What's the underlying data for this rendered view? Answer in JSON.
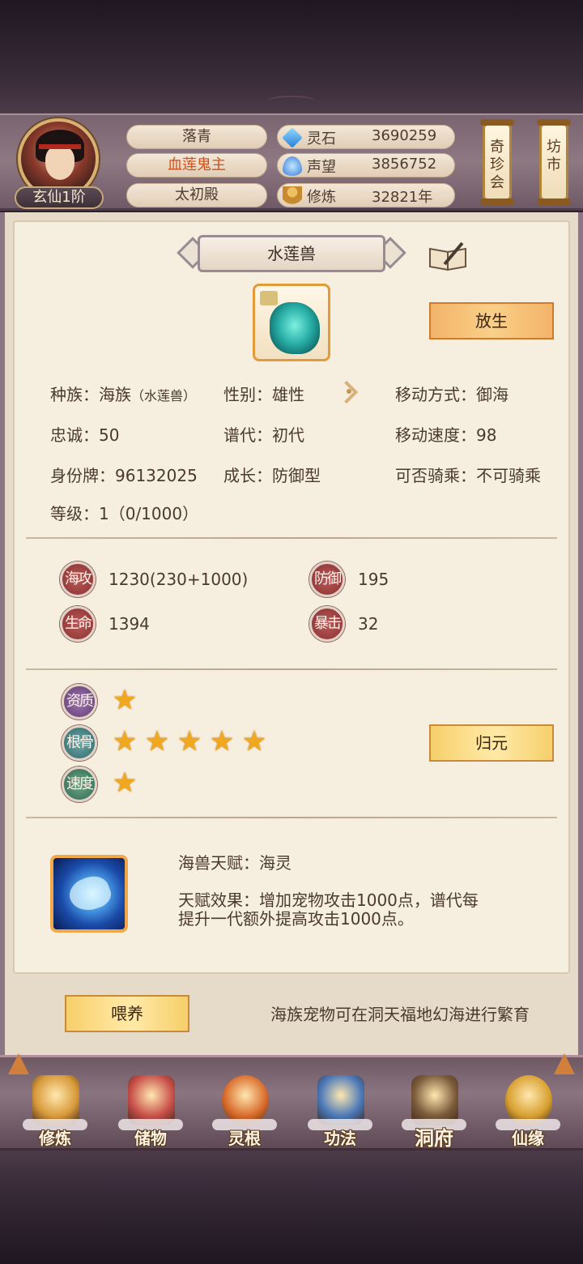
{
  "header": {
    "rank": "玄仙1阶",
    "names": [
      "落青",
      "血莲鬼主",
      "太初殿"
    ],
    "resources": [
      {
        "icon": "spirit-stone-icon",
        "label": "灵石",
        "value": "3690259"
      },
      {
        "icon": "reputation-icon",
        "label": "声望",
        "value": "3856752"
      },
      {
        "icon": "cultivation-icon",
        "label": "修炼",
        "value": "32821年"
      }
    ],
    "treasure_fair": "奇珍会",
    "market": "坊市"
  },
  "pet": {
    "title": "水莲兽",
    "release_label": "放生",
    "info": {
      "race_label": "种族：海族",
      "race_sub": "（水莲兽）",
      "gender": "性别：雄性",
      "move_mode": "移动方式：御海",
      "loyalty": "忠诚：50",
      "generation": "谱代：初代",
      "move_speed": "移动速度：98",
      "id_tag": "身份牌：96132025",
      "growth": "成长：防御型",
      "rideable": "可否骑乘：不可骑乘",
      "level": "等级：1（0/1000）"
    },
    "stats": [
      {
        "badge": "海攻",
        "value": "1230(230+1000)"
      },
      {
        "badge": "防御",
        "value": "195"
      },
      {
        "badge": "生命",
        "value": "1394"
      },
      {
        "badge": "暴击",
        "value": "32"
      }
    ],
    "ratings": [
      {
        "badge": "资质",
        "stars": 1
      },
      {
        "badge": "根骨",
        "stars": 5
      },
      {
        "badge": "速度",
        "stars": 1
      }
    ],
    "guiyuan_label": "归元",
    "talent_name": "海兽天赋：海灵",
    "talent_effect_1": "天赋效果：增加宠物攻击1000点，谱代每",
    "talent_effect_2": "提升一代额外提高攻击1000点。",
    "feed_label": "喂养",
    "hint": "海族宠物可在洞天福地幻海进行繁育"
  },
  "nav": [
    {
      "label": "修炼",
      "icon": "cultivation-icon",
      "color": "#d89a3a"
    },
    {
      "label": "储物",
      "icon": "storage-bag-icon",
      "color": "#c8504a"
    },
    {
      "label": "灵根",
      "icon": "spirit-root-icon",
      "color": "#d86a2a"
    },
    {
      "label": "功法",
      "icon": "scripture-book-icon",
      "color": "#4a78b8"
    },
    {
      "label": "洞府",
      "icon": "cave-mansion-icon",
      "color": "#7a5a3a"
    },
    {
      "label": "仙缘",
      "icon": "gourd-icon",
      "color": "#d8a030"
    }
  ]
}
